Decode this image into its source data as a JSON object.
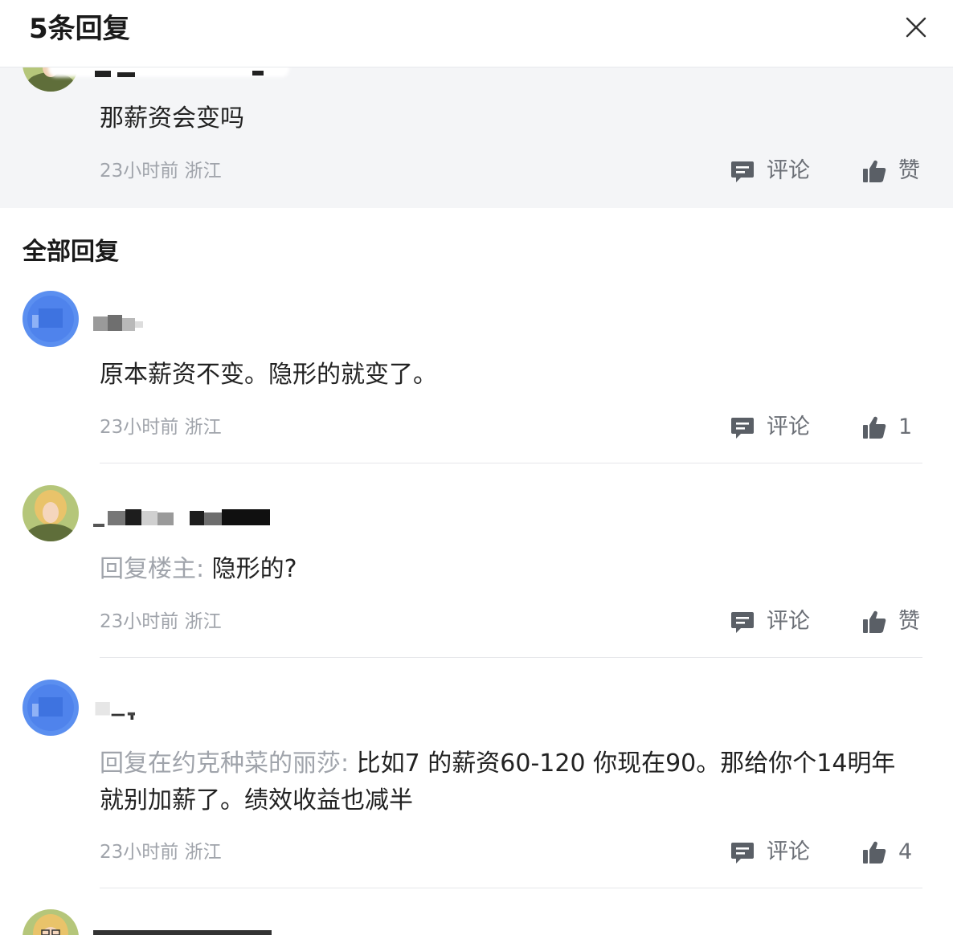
{
  "header": {
    "title": "5条回复"
  },
  "main_comment": {
    "text": "那薪资会变吗",
    "meta": "23小时前 浙江",
    "comment_label": "评论",
    "like_label": "赞"
  },
  "section": {
    "title": "全部回复"
  },
  "replies": [
    {
      "prefix": "",
      "text": "原本薪资不变。隐形的就变了。",
      "meta": "23小时前 浙江",
      "comment_label": "评论",
      "like_label": "1"
    },
    {
      "prefix": "回复楼主:",
      "text": "隐形的?",
      "meta": "23小时前 浙江",
      "comment_label": "评论",
      "like_label": "赞"
    },
    {
      "prefix": "回复在约克种菜的丽莎:",
      "text": "比如7 的薪资60-120 你现在90。那给你个14明年就别加薪了。绩效收益也减半",
      "meta": "23小时前 浙江",
      "comment_label": "评论",
      "like_label": "4"
    }
  ],
  "colors": {
    "highlight_bg": "#f4f5f7",
    "meta_gray": "#a0a4ab",
    "action_gray": "#6b6f76",
    "avatar_blue": "#5b8ff0"
  },
  "icons": {
    "close": "close-icon",
    "comment": "comment-bubble-icon",
    "like": "thumbs-up-icon"
  }
}
